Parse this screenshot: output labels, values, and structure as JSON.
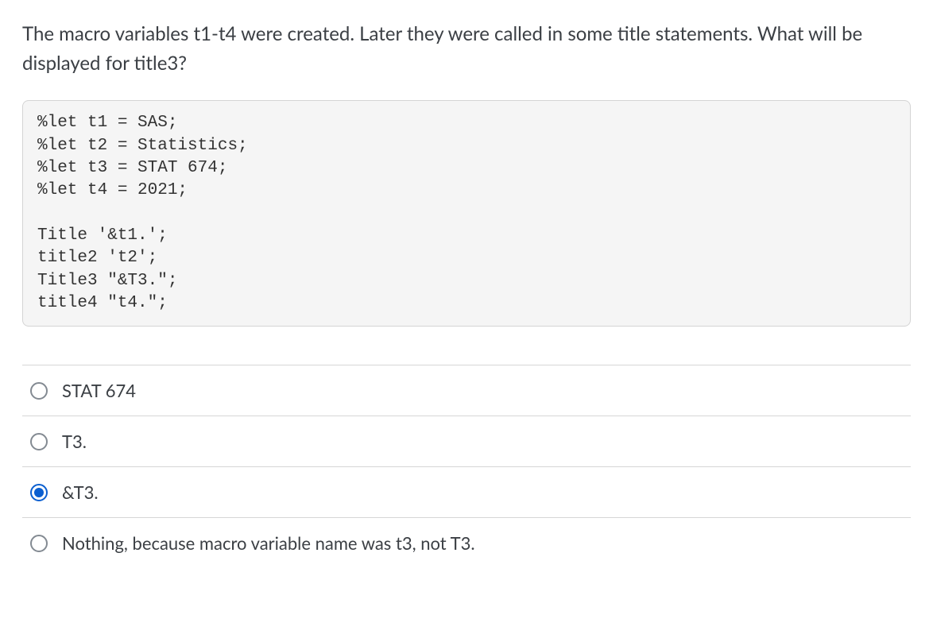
{
  "question": "The macro variables t1-t4 were created.  Later they were called in some title statements.  What will be displayed for  title3?",
  "code": "%let t1 = SAS;\n%let t2 = Statistics;\n%let t3 = STAT 674;\n%let t4 = 2021;\n\nTitle '&t1.';\ntitle2 't2';\nTitle3 \"&T3.\";\ntitle4 \"t4.\";",
  "options": [
    {
      "label": "STAT 674",
      "selected": false
    },
    {
      "label": "T3.",
      "selected": false
    },
    {
      "label": "&T3.",
      "selected": true
    },
    {
      "label": "Nothing, because macro variable name was t3, not T3.",
      "selected": false
    }
  ]
}
